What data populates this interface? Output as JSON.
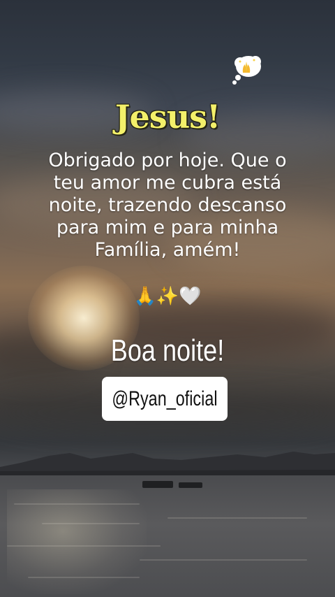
{
  "title": "Jesus!",
  "prayer_lines": [
    "Obrigado por hoje. Que o",
    "teu amor me cubra está",
    "noite, trazendo descanso",
    "para mim e para minha",
    "Família, amém!"
  ],
  "emojis": "🙏✨🤍",
  "goodnight": "Boa noite!",
  "handle": "@Ryan_oficial",
  "colors": {
    "title_yellow": "#f3f06a",
    "text_white": "#ffffff",
    "handle_bg": "#ffffff"
  },
  "icons": [
    "thought-bubble-praying-icon"
  ]
}
